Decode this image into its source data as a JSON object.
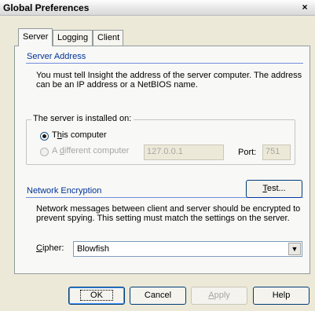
{
  "window": {
    "title": "Global Preferences",
    "close_glyph": "×"
  },
  "tabs": [
    {
      "label": "Server",
      "active": true
    },
    {
      "label": "Logging",
      "active": false
    },
    {
      "label": "Client",
      "active": false
    }
  ],
  "server_address": {
    "heading": "Server Address",
    "description_line1": "You must tell Insight the address of the server computer. The address",
    "description_line2": "can be an IP address or a NetBIOS name.",
    "group_label": "The server is installed on:",
    "option_this_computer": {
      "label_prefix": "T",
      "label_accel": "h",
      "label_rest": "is computer",
      "checked": true
    },
    "option_different_computer": {
      "label_prefix": "A ",
      "label_accel": "d",
      "label_rest": "ifferent computer",
      "checked": false,
      "enabled": false
    },
    "address_value": "127.0.0.1",
    "port_label": "Port:",
    "port_value": "751"
  },
  "test_button": {
    "accel": "T",
    "rest": "est..."
  },
  "network_encryption": {
    "heading": "Network Encryption",
    "description_line1": "Network messages between client and server should be encrypted to",
    "description_line2": "prevent spying. This setting must match the settings on the server.",
    "cipher_label_accel": "C",
    "cipher_label_rest": "ipher:",
    "cipher_value": "Blowfish"
  },
  "buttons": {
    "ok": "OK",
    "cancel": "Cancel",
    "apply_accel": "A",
    "apply_rest": "pply",
    "help": "Help"
  },
  "colors": {
    "section_heading": "#003399",
    "window_bg": "#ece9d8"
  }
}
